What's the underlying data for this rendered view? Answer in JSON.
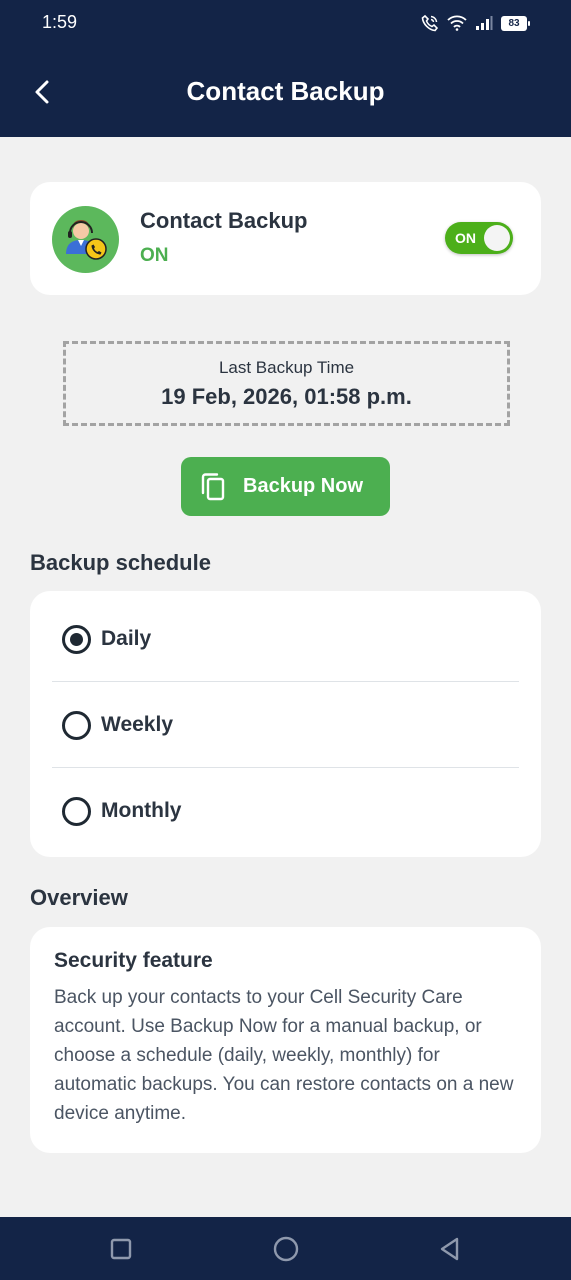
{
  "status_bar": {
    "time": "1:59",
    "battery": "83",
    "icons": [
      "wifi-call-icon",
      "wifi-icon",
      "signal-icon",
      "battery-icon"
    ]
  },
  "app_bar": {
    "title": "Contact Backup",
    "back_icon": "chevron-left-icon"
  },
  "backup_toggle": {
    "title": "Contact Backup",
    "state_text": "ON",
    "switch_label": "ON",
    "enabled": true,
    "icon": "contact-avatar-phone-icon"
  },
  "last_backup": {
    "label": "Last Backup Time",
    "value": "19 Feb, 2026, 01:58 p.m."
  },
  "backup_button": {
    "label": "Backup Now",
    "icon": "copy-icon"
  },
  "schedule": {
    "heading": "Backup schedule",
    "options": [
      {
        "label": "Daily",
        "selected": true
      },
      {
        "label": "Weekly",
        "selected": false
      },
      {
        "label": "Monthly",
        "selected": false
      }
    ]
  },
  "overview": {
    "heading": "Overview",
    "title": "Security feature",
    "text": "Back up your contacts to your Cell Security Care account. Use Backup Now for a manual backup, or choose a schedule (daily, weekly, monthly) for automatic backups. You can restore contacts on a new device anytime."
  },
  "colors": {
    "header_bg": "#132447",
    "accent_green": "#4caf50",
    "switch_green": "#4caf1a",
    "page_bg": "#f1f1f1"
  },
  "nav_bar": {
    "icons": [
      "recent-apps-icon",
      "home-icon",
      "back-icon"
    ]
  }
}
